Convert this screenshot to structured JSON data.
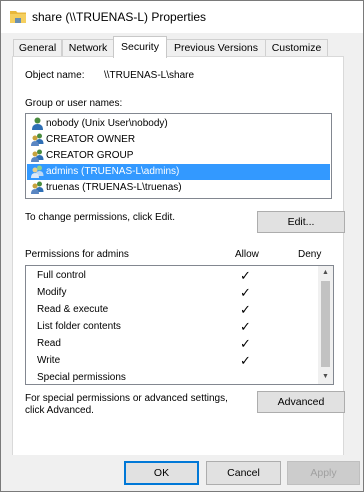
{
  "window": {
    "title": "share (\\\\TRUENAS-L) Properties"
  },
  "tabs": [
    {
      "label": "General",
      "active": false
    },
    {
      "label": "Network",
      "active": false
    },
    {
      "label": "Security",
      "active": true
    },
    {
      "label": "Previous Versions",
      "active": false
    },
    {
      "label": "Customize",
      "active": false
    }
  ],
  "security": {
    "object_name_label": "Object name:",
    "object_name_value": "\\\\TRUENAS-L\\share",
    "group_label": "Group or user names:",
    "users": [
      {
        "name": "nobody (Unix User\\nobody)",
        "icon": "user-icon",
        "selected": false
      },
      {
        "name": "CREATOR OWNER",
        "icon": "group-icon",
        "selected": false
      },
      {
        "name": "CREATOR GROUP",
        "icon": "group-icon",
        "selected": false
      },
      {
        "name": "admins (TRUENAS-L\\admins)",
        "icon": "group-icon",
        "selected": true
      },
      {
        "name": "truenas (TRUENAS-L\\truenas)",
        "icon": "group-icon",
        "selected": false
      }
    ],
    "change_text": "To change permissions, click Edit.",
    "edit_label": "Edit...",
    "permissions_for": "Permissions for admins",
    "allow_header": "Allow",
    "deny_header": "Deny",
    "permissions": [
      {
        "name": "Full control",
        "allow": true,
        "deny": false
      },
      {
        "name": "Modify",
        "allow": true,
        "deny": false
      },
      {
        "name": "Read & execute",
        "allow": true,
        "deny": false
      },
      {
        "name": "List folder contents",
        "allow": true,
        "deny": false
      },
      {
        "name": "Read",
        "allow": true,
        "deny": false
      },
      {
        "name": "Write",
        "allow": true,
        "deny": false
      },
      {
        "name": "Special permissions",
        "allow": false,
        "deny": false
      }
    ],
    "check_glyph": "✓",
    "advanced_text_line1": "For special permissions or advanced settings,",
    "advanced_text_line2": "click Advanced.",
    "advanced_label": "Advanced"
  },
  "footer": {
    "ok_label": "OK",
    "cancel_label": "Cancel",
    "apply_label": "Apply"
  },
  "colors": {
    "selection": "#3399ff",
    "accent": "#0078d7"
  }
}
